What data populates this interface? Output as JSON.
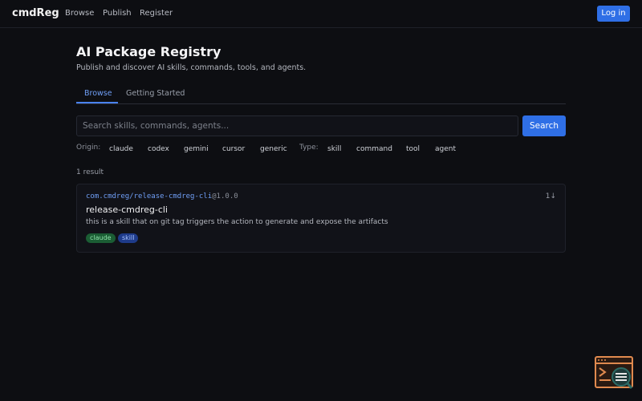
{
  "nav": {
    "brand": "cmdReg",
    "links": [
      "Browse",
      "Publish",
      "Register"
    ],
    "login_label": "Log in"
  },
  "header": {
    "title": "AI Package Registry",
    "subtitle": "Publish and discover AI skills, commands, tools, and agents."
  },
  "tabs": [
    {
      "label": "Browse",
      "active": true
    },
    {
      "label": "Getting Started",
      "active": false
    }
  ],
  "search": {
    "placeholder": "Search skills, commands, agents...",
    "value": "",
    "button_label": "Search"
  },
  "filters": {
    "origin_label": "Origin:",
    "origins": [
      "claude",
      "codex",
      "gemini",
      "cursor",
      "generic"
    ],
    "type_label": "Type:",
    "types": [
      "skill",
      "command",
      "tool",
      "agent"
    ]
  },
  "results": {
    "count_text": "1 result",
    "items": [
      {
        "id": "com.cmdreg/release-cmdreg-cli",
        "version": "@1.0.0",
        "downloads": "1↓",
        "name": "release-cmdreg-cli",
        "description": "this is a skill that on git tag triggers the action to generate and expose the artifacts",
        "tags": [
          "claude",
          "skill"
        ]
      }
    ]
  },
  "colors": {
    "accent": "#2f6fe6",
    "link": "#6f9ef5",
    "background": "#0d0e12",
    "tag_green": "#1b5d34",
    "tag_blue": "#1e3b8a"
  },
  "icons": {
    "widget": "terminal-search-icon"
  }
}
